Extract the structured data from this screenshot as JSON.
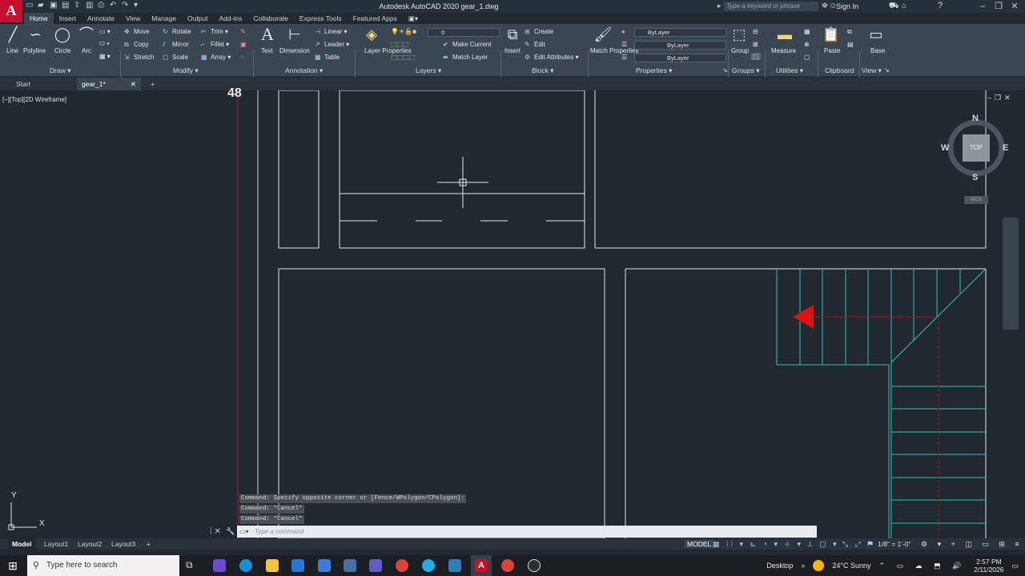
{
  "app": {
    "title": "Autodesk AutoCAD 2020   gear_1.dwg",
    "logo": "A",
    "search_placeholder": "Type a keyword or phrase",
    "sign_in": "Sign In"
  },
  "ribbon_tabs": [
    "Home",
    "Insert",
    "Annotate",
    "View",
    "Manage",
    "Output",
    "Add-ins",
    "Collaborate",
    "Express Tools",
    "Featured Apps"
  ],
  "panels": {
    "draw": {
      "title": "Draw",
      "tools": [
        "Line",
        "Polyline",
        "Circle",
        "Arc"
      ]
    },
    "modify": {
      "title": "Modify",
      "tools": [
        "Move",
        "Rotate",
        "Trim",
        "Copy",
        "Mirror",
        "Fillet",
        "Stretch",
        "Scale",
        "Array"
      ]
    },
    "annotation": {
      "title": "Annotation",
      "tools": [
        "Text",
        "Dimension",
        "Linear",
        "Leader",
        "Table"
      ]
    },
    "layers": {
      "title": "Layers",
      "layer_properties": "Layer Properties",
      "current_layer": "0",
      "make_current": "Make Current",
      "match_layer": "Match Layer"
    },
    "block": {
      "title": "Block",
      "insert": "Insert",
      "create": "Create",
      "edit": "Edit",
      "edit_attributes": "Edit Attributes"
    },
    "properties": {
      "title": "Properties",
      "match_properties": "Match Properties",
      "color": "ByLayer",
      "linetype": "ByLayer",
      "lineweight": "ByLayer"
    },
    "groups": {
      "title": "Groups",
      "group": "Group"
    },
    "utilities": {
      "title": "Utilities",
      "measure": "Measure"
    },
    "clipboard": {
      "title": "Clipboard",
      "paste": "Paste"
    },
    "view": {
      "title": "View",
      "base": "Base"
    }
  },
  "file_tabs": [
    "Start",
    "gear_1*"
  ],
  "viewport_label": "[–][Top][2D Wireframe]",
  "canvas": {
    "dimension_text": "48",
    "viewcube": {
      "n": "N",
      "s": "S",
      "e": "E",
      "w": "W",
      "face": "TOP",
      "wcs": "WCS"
    },
    "ucs": {
      "x": "X",
      "y": "Y"
    }
  },
  "command": {
    "history": [
      "Command: Specify opposite corner or [Fence/WPolygon/CPolygon]:",
      "Command: *Cancel*",
      "Command: *Cancel*"
    ],
    "placeholder": "Type a command"
  },
  "layout_tabs": [
    "Model",
    "Layout1",
    "Layout2",
    "Layout3"
  ],
  "status": {
    "space": "MODEL",
    "scale": "1/8\" = 1'-0\""
  },
  "taskbar": {
    "search_placeholder": "Type here to search",
    "desktop": "Desktop",
    "weather": "24°C  Sunny",
    "time": "2:57 PM",
    "date": "2/11/2026"
  },
  "colors": {
    "accent_red": "#c8102e",
    "ribbon_bg": "#3b4653",
    "canvas_bg": "#212830",
    "stair_cyan": "#2ec4b6"
  }
}
